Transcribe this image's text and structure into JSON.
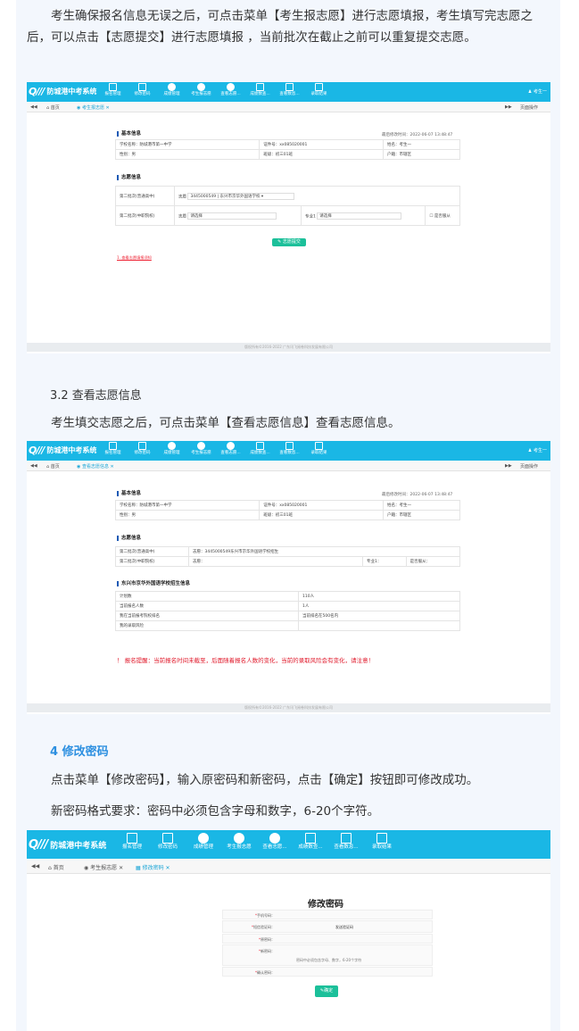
{
  "paragraphs": {
    "p1": "考生确保报名信息无误之后，可点击菜单【考生报志愿】进行志愿填报，考生填写完志愿之后，可以点击【志愿提交】进行志愿填报 ，当前批次在截止之前可以重复提交志愿。",
    "h32": "3.2 查看志愿信息",
    "p2": "考生填交志愿之后，可点击菜单【查看志愿信息】查看志愿信息。",
    "h4": "4 修改密码",
    "p3": "点击菜单【修改密码】，输入原密码和新密码，点击【确定】按钮即可修改成功。",
    "p4": "新密码格式要求：密码中必须包含字母和数字，6-20个字符。"
  },
  "app": {
    "title": "防城港中考系统",
    "user": "考生一",
    "home_tab": "首页",
    "ops": "页面操作",
    "nav": [
      "报名管理",
      "修改密码",
      "成绩管理",
      "考生报志愿",
      "查看志愿...",
      "成绩数查...",
      "查看数息...",
      "录取结果"
    ],
    "footer": "版权所有©2016-2022 广东讯飞阅卷科技发展有限公司",
    "timestamp": "最后修改时间：2022-06-07 13:48:47"
  },
  "shot1": {
    "tab": "考生报志愿",
    "basic_title": "基本信息",
    "basic": [
      [
        "学校名称：防城港市第一中学",
        "证件号：xx085020001",
        "姓名：考生一"
      ],
      [
        "性别：男",
        "班级：初三01班",
        "户籍：市辖区"
      ]
    ],
    "wish_title": "志愿信息",
    "row1_label": "第二批次(普通高中)",
    "row1_wish": "志愿",
    "row1_value": "3445000549 | 东兴市京华外国语学校",
    "row2_label": "第二批次(中职院校)",
    "row2_wish": "志愿",
    "row2_value": "请选择",
    "major_label": "专业1",
    "major_value": "请选择",
    "obey": "是否服从",
    "submit": "志愿提交",
    "link": "1. 查看志愿填报须知"
  },
  "shot2": {
    "tab": "查看志愿信息",
    "basic_title": "基本信息",
    "basic": [
      [
        "学校名称：防城港市第一中学",
        "证件号：xx085020001",
        "姓名：考生一"
      ],
      [
        "性别：男",
        "班级：初三01班",
        "户籍：市辖区"
      ]
    ],
    "wish_title": "志愿信息",
    "wish": [
      [
        "第二批次(普通高中)",
        "志愿：3445000549东兴市京华外国语学校招生",
        ""
      ],
      [
        "第二批次(中职院校)",
        "志愿：",
        "专业1：",
        "是否服从："
      ]
    ],
    "school_title": "东兴市京华外国语学校招生信息",
    "school": [
      [
        "计划数",
        "110人"
      ],
      [
        "当前报名人数",
        "1人"
      ],
      [
        "我在当前报考院校排名",
        "当前排名在500名内"
      ],
      [
        "我的录取风险",
        ""
      ]
    ],
    "warning": "！ 报名提醒：当前报名时间未截至，后面随着报名人数的变化，当前的录取风险会有变化，请注意！"
  },
  "shot3": {
    "tab1": "考生报志愿",
    "tab2": "修改密码",
    "form_title": "修改密码",
    "fields": [
      {
        "label": "手机号码：",
        "value": ""
      },
      {
        "label": "短信验证码：",
        "value": "发送验证码"
      },
      {
        "label": "原密码：",
        "value": ""
      },
      {
        "label": "新密码：",
        "value": "密码中必须包含字母、数字，6-20个字符"
      },
      {
        "label": "确认密码：",
        "value": ""
      }
    ],
    "confirm": "确定"
  }
}
